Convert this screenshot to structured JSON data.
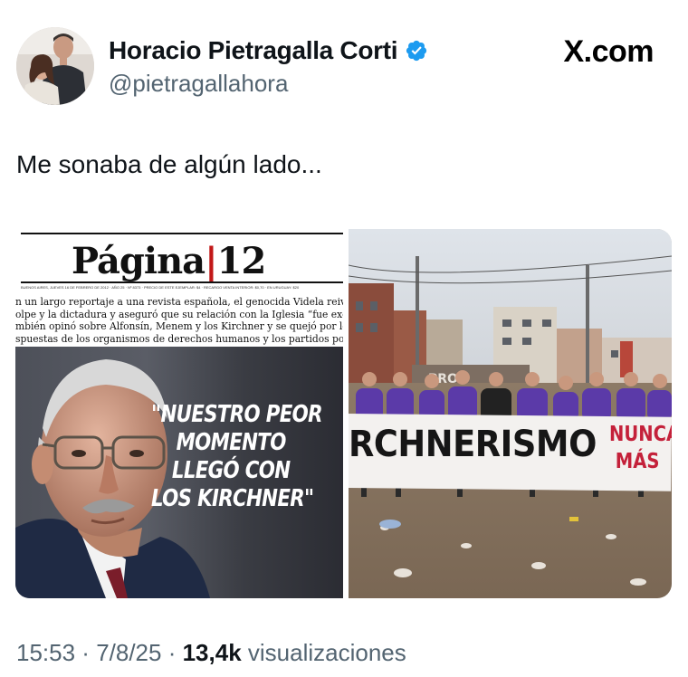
{
  "author": {
    "display_name": "Horacio Pietragalla Corti",
    "handle": "@pietragallahora",
    "verified": true,
    "verified_color": "#1d9bf0",
    "avatar_icon": "profile-photo"
  },
  "source": {
    "label": "X.com"
  },
  "tweet": {
    "text": "Me sonaba de algún lado..."
  },
  "media": {
    "newspaper": {
      "logo_main": "Página",
      "logo_bar": "|",
      "logo_number": "12",
      "dateline": "BUENOS AIRES, JUEVES 16 DE FEBRERO DE 2012 · AÑO 25 · Nº 8373 · PRECIO DE ESTE EJEMPLAR: $4 · RECARGO VENTA INTERIOR: $0,70 · EN URUGUAY: $20",
      "lede_lines": [
        "n un largo reportaje a una revista española, el genocida Videla reivindicó el",
        "olpe y la dictadura y aseguró que su relación con la Iglesia “fue excelente”.",
        "mbién opinó sobre Alfonsín, Menem y los Kirchner y se quejó por los juicios",
        "spuestas de los organismos de derechos humanos y los partidos políticos"
      ],
      "quote_lines": [
        "\"NUESTRO PEOR",
        "MOMENTO",
        "LLEGÓ CON",
        "LOS KIRCHNER\""
      ]
    },
    "protest_photo": {
      "banner_text": "RCHNERISMO",
      "banner_red_lines": [
        "NUNCA",
        "MÁS"
      ],
      "wall_text": "PRO"
    }
  },
  "meta": {
    "time": "15:53",
    "separator": " · ",
    "date": "7/8/25",
    "views_count": "13,4k",
    "views_label": " visualizaciones"
  }
}
